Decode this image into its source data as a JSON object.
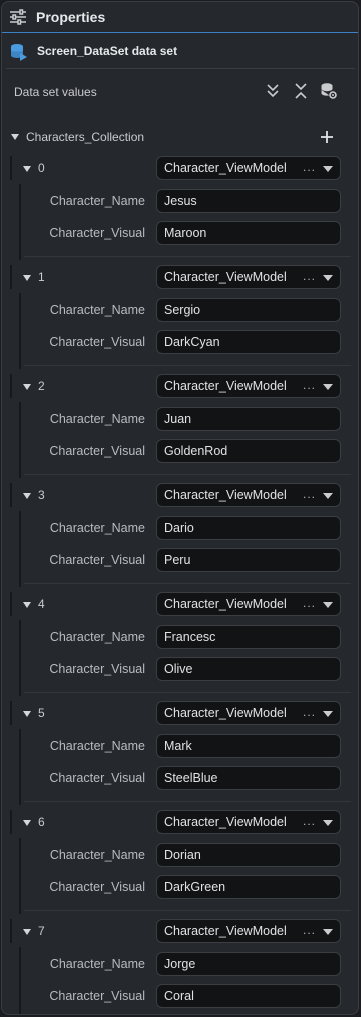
{
  "panel": {
    "title": "Properties",
    "dataset_label": "Screen_DataSet data set",
    "values_label": "Data set values",
    "collection_label": "Characters_Collection"
  },
  "items": [
    {
      "index": "0",
      "type": "Character_ViewModel",
      "ellipsis": "...",
      "name_label": "Character_Name",
      "name": "Jesus",
      "visual_label": "Character_Visual",
      "visual": "Maroon"
    },
    {
      "index": "1",
      "type": "Character_ViewModel",
      "ellipsis": "...",
      "name_label": "Character_Name",
      "name": "Sergio",
      "visual_label": "Character_Visual",
      "visual": "DarkCyan"
    },
    {
      "index": "2",
      "type": "Character_ViewModel",
      "ellipsis": "...",
      "name_label": "Character_Name",
      "name": "Juan",
      "visual_label": "Character_Visual",
      "visual": "GoldenRod"
    },
    {
      "index": "3",
      "type": "Character_ViewModel",
      "ellipsis": "...",
      "name_label": "Character_Name",
      "name": "Dario",
      "visual_label": "Character_Visual",
      "visual": "Peru"
    },
    {
      "index": "4",
      "type": "Character_ViewModel",
      "ellipsis": "...",
      "name_label": "Character_Name",
      "name": "Francesc",
      "visual_label": "Character_Visual",
      "visual": "Olive"
    },
    {
      "index": "5",
      "type": "Character_ViewModel",
      "ellipsis": "...",
      "name_label": "Character_Name",
      "name": "Mark",
      "visual_label": "Character_Visual",
      "visual": "SteelBlue"
    },
    {
      "index": "6",
      "type": "Character_ViewModel",
      "ellipsis": "...",
      "name_label": "Character_Name",
      "name": "Dorian",
      "visual_label": "Character_Visual",
      "visual": "DarkGreen"
    },
    {
      "index": "7",
      "type": "Character_ViewModel",
      "ellipsis": "...",
      "name_label": "Character_Name",
      "name": "Jorge",
      "visual_label": "Character_Visual",
      "visual": "Coral"
    }
  ],
  "icons": {
    "title": "sliders-icon",
    "dataset": "database-icon",
    "expand_all": "double-chevron-down-icon",
    "collapse_all": "collapse-icon",
    "db_settings": "database-settings-icon",
    "add": "plus-icon"
  },
  "colors": {
    "accent": "#3b82c4",
    "panel_bg": "#25282c",
    "field_bg": "#121315",
    "dataset_icon": "#4a9be0"
  }
}
